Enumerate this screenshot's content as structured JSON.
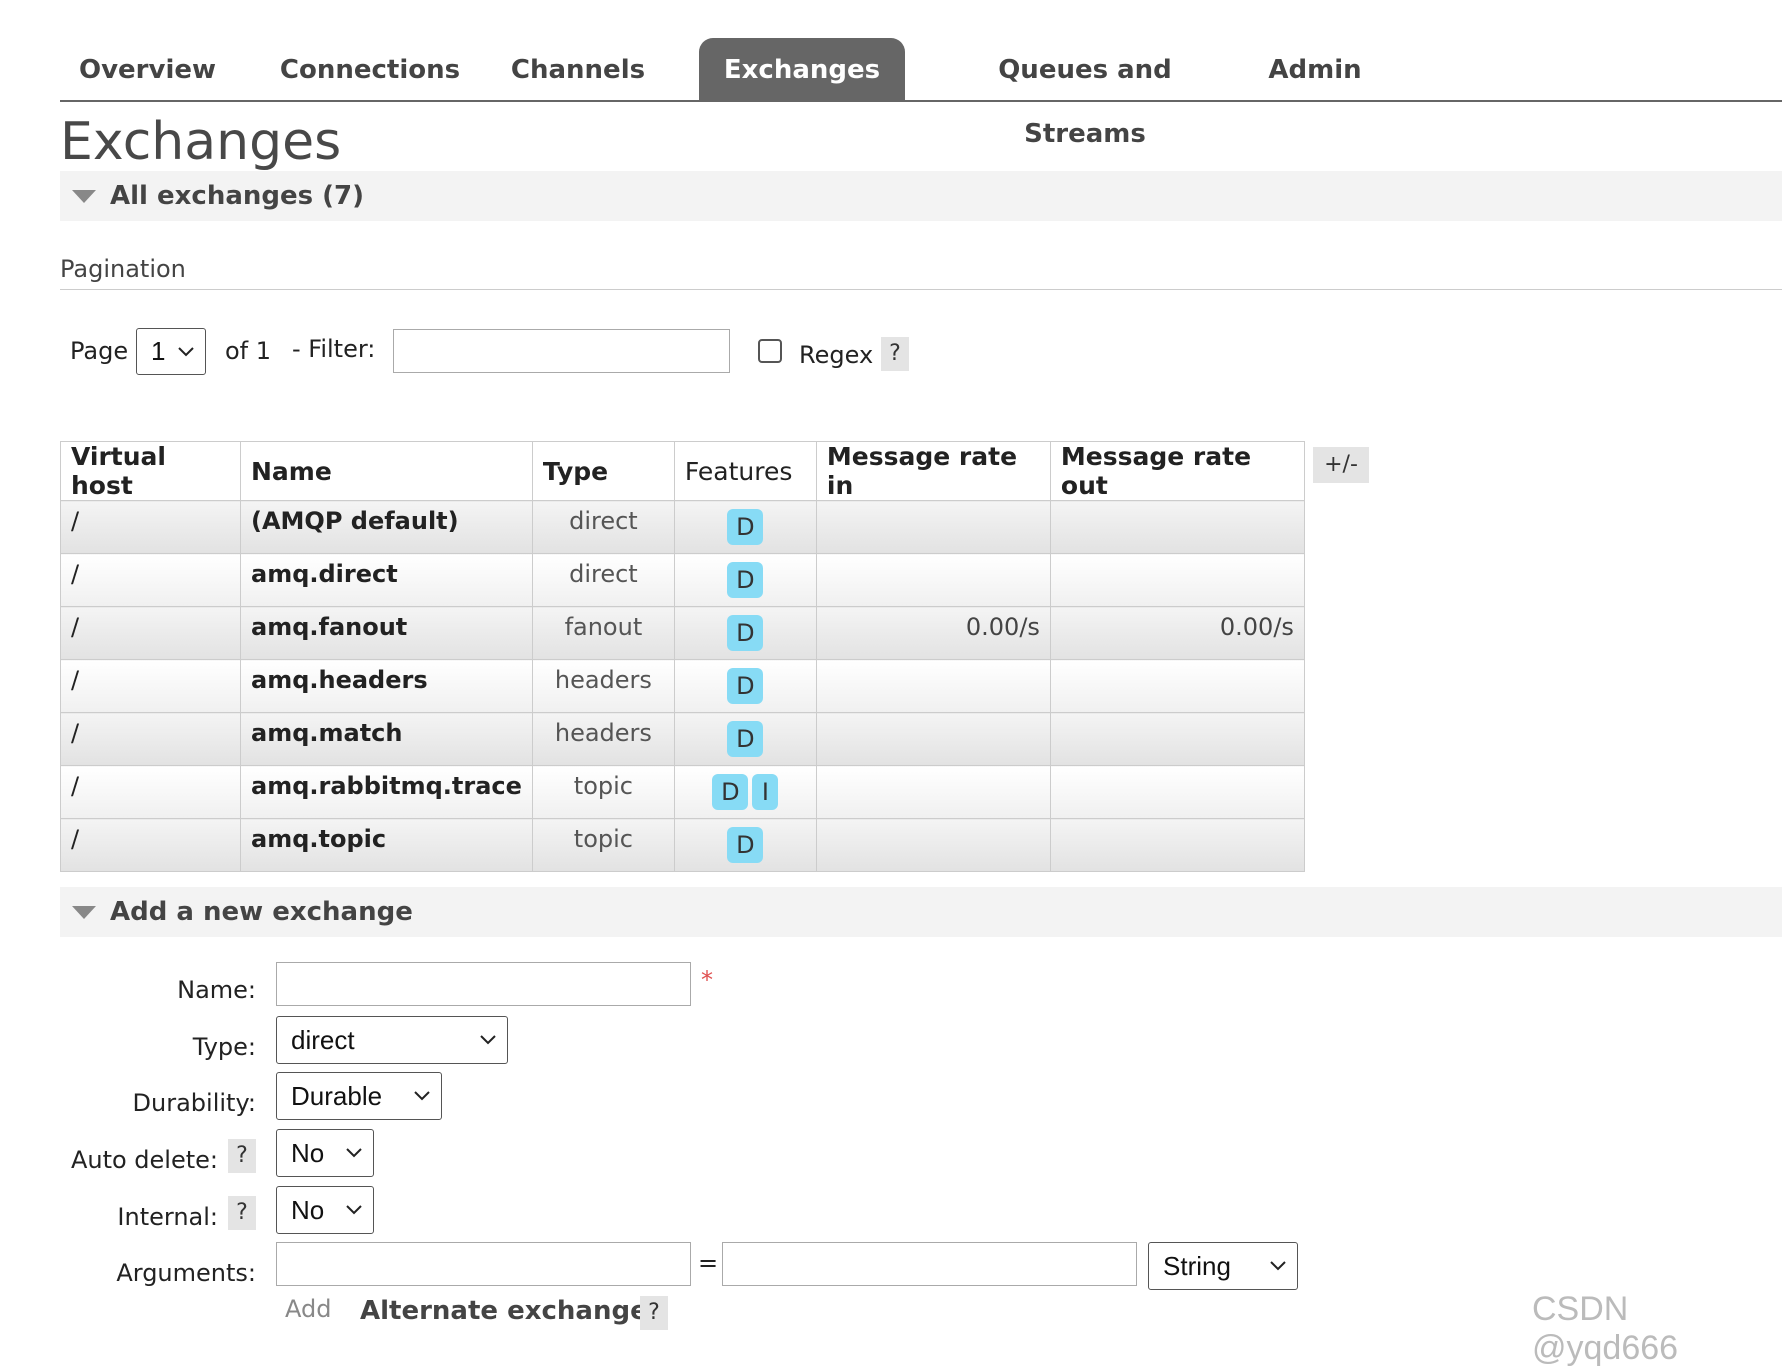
{
  "tabs": [
    {
      "label": "Overview"
    },
    {
      "label": "Connections"
    },
    {
      "label": "Channels"
    },
    {
      "label": "Exchanges",
      "active": true
    },
    {
      "label": "Queues and Streams"
    },
    {
      "label": "Admin"
    }
  ],
  "page_title": "Exchanges",
  "all_exchanges": {
    "label": "All exchanges (7)"
  },
  "pagination": {
    "title": "Pagination",
    "page_label": "Page",
    "page_value": "1",
    "of_label": "of 1",
    "filter_label": "- Filter:",
    "filter_value": "",
    "regex_label": "Regex",
    "regex_checked": false,
    "help": "?"
  },
  "table": {
    "columns": [
      "Virtual host",
      "Name",
      "Type",
      "Features",
      "Message rate in",
      "Message rate out"
    ],
    "toggle_columns": "+/-",
    "rows": [
      {
        "vhost": "/",
        "name": "(AMQP default)",
        "type": "direct",
        "features": [
          "D"
        ],
        "rate_in": "",
        "rate_out": ""
      },
      {
        "vhost": "/",
        "name": "amq.direct",
        "type": "direct",
        "features": [
          "D"
        ],
        "rate_in": "",
        "rate_out": ""
      },
      {
        "vhost": "/",
        "name": "amq.fanout",
        "type": "fanout",
        "features": [
          "D"
        ],
        "rate_in": "0.00/s",
        "rate_out": "0.00/s"
      },
      {
        "vhost": "/",
        "name": "amq.headers",
        "type": "headers",
        "features": [
          "D"
        ],
        "rate_in": "",
        "rate_out": ""
      },
      {
        "vhost": "/",
        "name": "amq.match",
        "type": "headers",
        "features": [
          "D"
        ],
        "rate_in": "",
        "rate_out": ""
      },
      {
        "vhost": "/",
        "name": "amq.rabbitmq.trace",
        "type": "topic",
        "features": [
          "D",
          "I"
        ],
        "rate_in": "",
        "rate_out": ""
      },
      {
        "vhost": "/",
        "name": "amq.topic",
        "type": "topic",
        "features": [
          "D"
        ],
        "rate_in": "",
        "rate_out": ""
      }
    ]
  },
  "add_exchange": {
    "label": "Add a new exchange",
    "name_label": "Name:",
    "name_value": "",
    "required_mark": "*",
    "type_label": "Type:",
    "type_value": "direct",
    "durability_label": "Durability:",
    "durability_value": "Durable",
    "auto_delete_label": "Auto delete:",
    "auto_delete_value": "No",
    "internal_label": "Internal:",
    "internal_value": "No",
    "arguments_label": "Arguments:",
    "arguments_key": "",
    "equals": "=",
    "arguments_value": "",
    "arguments_type": "String",
    "add_label": "Add",
    "alternate_exchange_label": "Alternate exchange",
    "help": "?"
  },
  "watermark": "CSDN @yqd666",
  "colors": {
    "active_tab": "#666666",
    "feature_badge": "#87dbf5",
    "required": "#e05050"
  }
}
